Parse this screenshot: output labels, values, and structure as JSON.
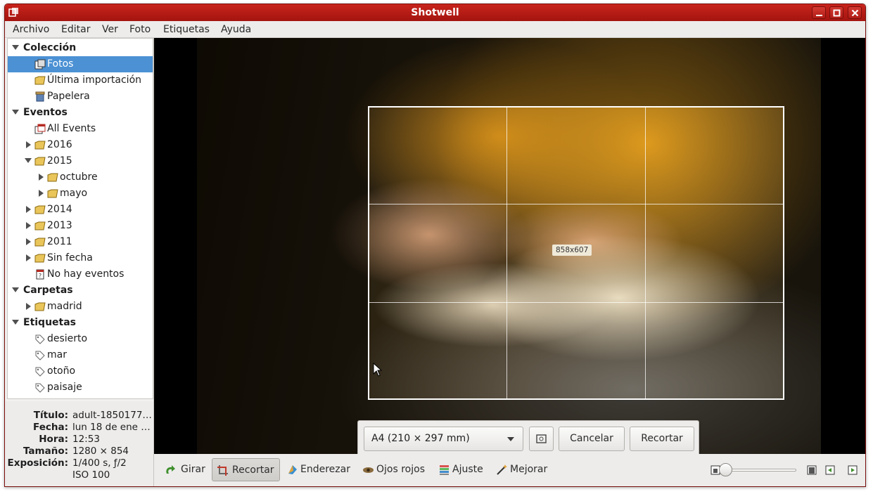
{
  "window": {
    "title": "Shotwell"
  },
  "menubar": [
    "Archivo",
    "Editar",
    "Ver",
    "Foto",
    "Etiquetas",
    "Ayuda"
  ],
  "sidebar": {
    "coleccion": {
      "header": "Colección",
      "items": [
        "Fotos",
        "Última importación",
        "Papelera"
      ]
    },
    "eventos": {
      "header": "Eventos",
      "all_events": "All Events",
      "years": [
        "2016",
        "2015",
        "2014",
        "2013",
        "2011"
      ],
      "months_2015": [
        "octubre",
        "mayo"
      ],
      "sin_fecha": "Sin fecha",
      "no_events": "No hay eventos"
    },
    "carpetas": {
      "header": "Carpetas",
      "items": [
        "madrid"
      ]
    },
    "etiquetas": {
      "header": "Etiquetas",
      "items": [
        "desierto",
        "mar",
        "otoño",
        "paisaje"
      ]
    },
    "selected": "Fotos"
  },
  "info": {
    "titulo_key": "Título:",
    "titulo_val": "adult-1850177…",
    "fecha_key": "Fecha:",
    "fecha_val": "lun 18 de ene …",
    "hora_key": "Hora:",
    "hora_val": "12:53",
    "tamano_key": "Tamaño:",
    "tamano_val": "1280 × 854",
    "exposicion_key": "Exposición:",
    "exposicion_val": "1/400 s, ƒ/2",
    "iso_val": "ISO 100"
  },
  "crop": {
    "size_label": "858x607",
    "ratio_selected": "A4 (210 × 297 mm)",
    "cancel_label": "Cancelar",
    "apply_label": "Recortar"
  },
  "toolbar": {
    "rotate": "Girar",
    "crop": "Recortar",
    "straighten": "Enderezar",
    "redeye": "Ojos rojos",
    "adjust": "Ajuste",
    "enhance": "Mejorar",
    "active": "Recortar",
    "zoom_level": 0.0
  },
  "colors": {
    "titlebar": "#b81a13",
    "selection": "#4b91d4"
  }
}
